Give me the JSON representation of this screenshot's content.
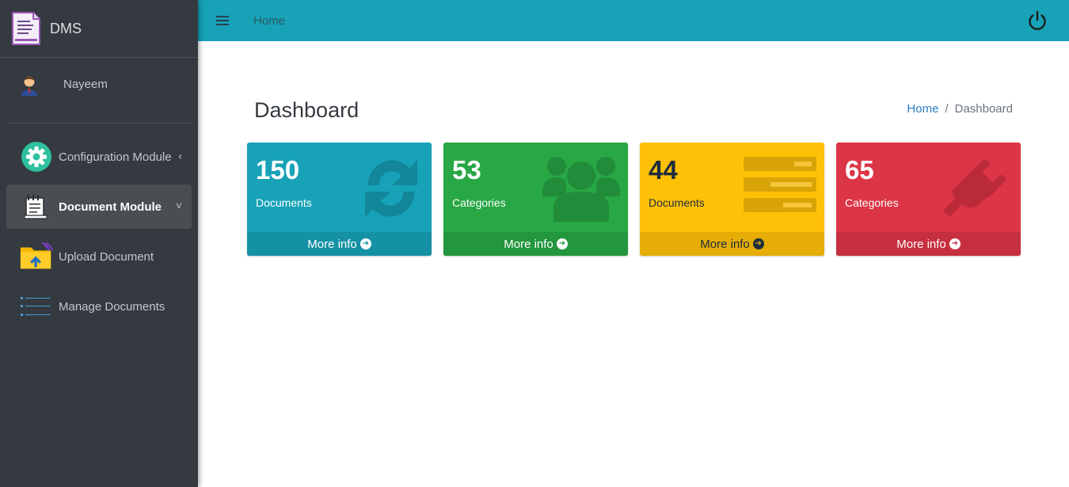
{
  "brand": {
    "name": "DMS",
    "icon": "document-list-icon"
  },
  "user": {
    "name": "Nayeem",
    "icon": "user-avatar-icon"
  },
  "sidebar": {
    "items": [
      {
        "label": "Configuration Module",
        "icon": "gear-icon",
        "arrow": "‹",
        "active": false
      },
      {
        "label": "Document Module",
        "icon": "document-icon",
        "arrow": "˅",
        "active": true
      },
      {
        "label": "Upload Document",
        "icon": "folder-upload-icon",
        "active": false
      },
      {
        "label": "Manage Documents",
        "icon": "list-icon",
        "active": false
      }
    ]
  },
  "topbar": {
    "home_label": "Home",
    "menu_icon": "hamburger-icon",
    "power_icon": "power-icon"
  },
  "page": {
    "title": "Dashboard",
    "breadcrumb": {
      "home": "Home",
      "separator": "/",
      "current": "Dashboard"
    }
  },
  "cards": [
    {
      "value": "150",
      "label": "Documents",
      "footer": "More info",
      "color": "#17a2b8",
      "icon": "refresh-icon"
    },
    {
      "value": "53",
      "label": "Categories",
      "footer": "More info",
      "color": "#28a745",
      "icon": "users-icon"
    },
    {
      "value": "44",
      "label": "Documents",
      "footer": "More info",
      "color": "#ffc107",
      "icon": "list-bars-icon"
    },
    {
      "value": "65",
      "label": "Categories",
      "footer": "More info",
      "color": "#dc3545",
      "icon": "plug-icon"
    }
  ],
  "colors": {
    "sidebar": "#343a40",
    "topbar": "#17a2b8",
    "link": "#2a7bc3"
  }
}
